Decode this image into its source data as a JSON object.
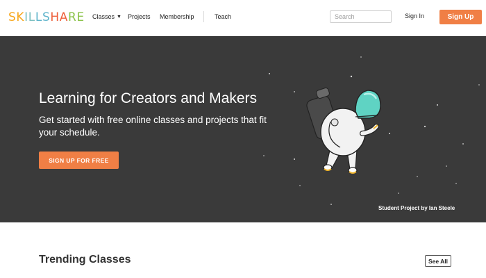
{
  "logo": {
    "letters": [
      "S",
      "K",
      "I",
      "L",
      "L",
      "S",
      "H",
      "A",
      "R",
      "E"
    ],
    "colors": [
      "#f7a61a",
      "#f7a61a",
      "#7cc0c0",
      "#7cc0c0",
      "#5fb4cb",
      "#5fb4cb",
      "#ee5f3a",
      "#ee5f3a",
      "#8bc34a",
      "#8bc34a"
    ]
  },
  "nav": {
    "classes": "Classes",
    "projects": "Projects",
    "membership": "Membership",
    "teach": "Teach"
  },
  "search": {
    "placeholder": "Search",
    "value": ""
  },
  "auth": {
    "signin": "Sign In",
    "signup": "Sign Up"
  },
  "hero": {
    "title": "Learning for Creators and Makers",
    "subtitle": "Get started with free online classes and projects that fit your schedule.",
    "cta": "SIGN UP FOR FREE",
    "credit": "Student Project by Ian Steele"
  },
  "trending": {
    "title": "Trending Classes",
    "see_all": "See All"
  },
  "colors": {
    "accent": "#f07f45",
    "hero_bg": "#3a3a3a",
    "helmet": "#5fd3c3"
  },
  "icons": {
    "dropdown": "chevron-down-icon",
    "illustration": "astronaut-illustration"
  }
}
